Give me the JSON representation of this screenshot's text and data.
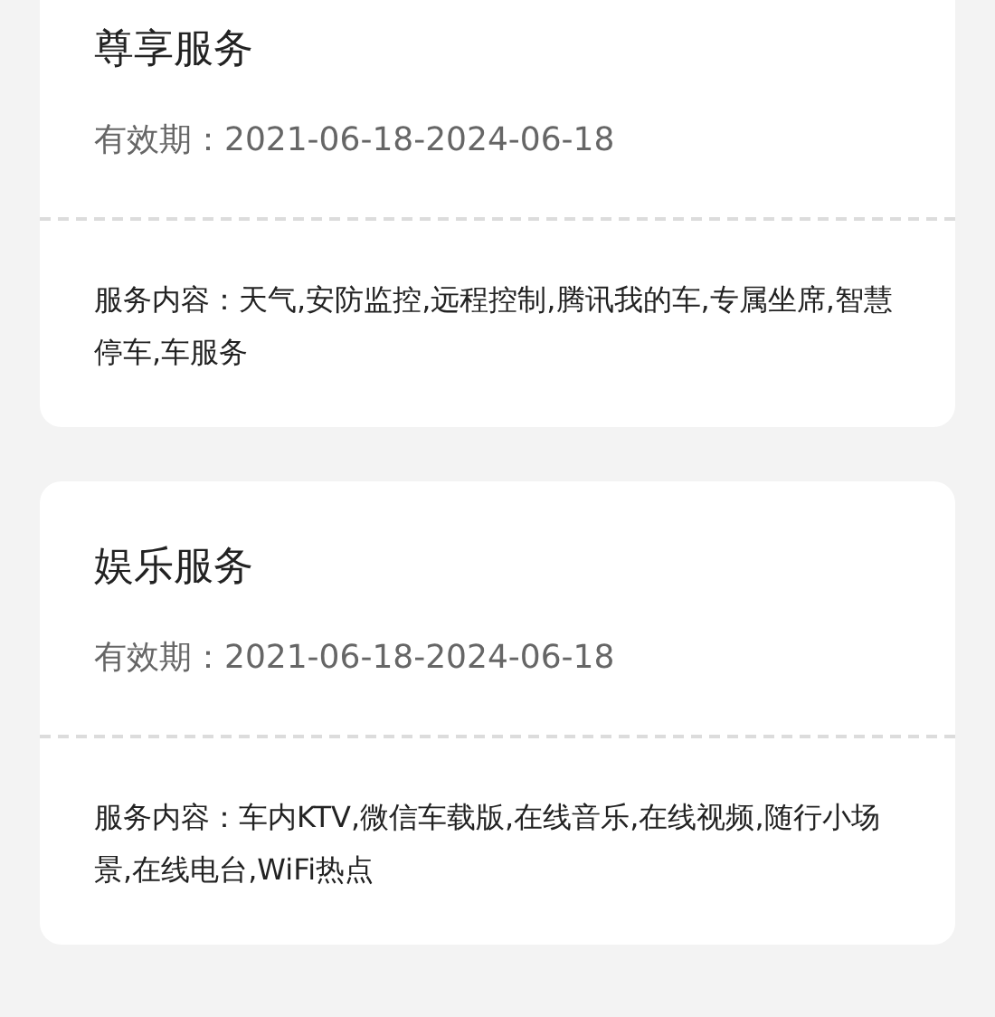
{
  "cards": [
    {
      "title": "尊享服务",
      "validity": "有效期：2021-06-18-2024-06-18",
      "content": "服务内容：天气,安防监控,远程控制,腾讯我的车,专属坐席,智慧停车,车服务"
    },
    {
      "title": "娱乐服务",
      "validity": "有效期：2021-06-18-2024-06-18",
      "content": "服务内容：车内KTV,微信车载版,在线音乐,在线视频,随行小场景,在线电台,WiFi热点"
    }
  ]
}
